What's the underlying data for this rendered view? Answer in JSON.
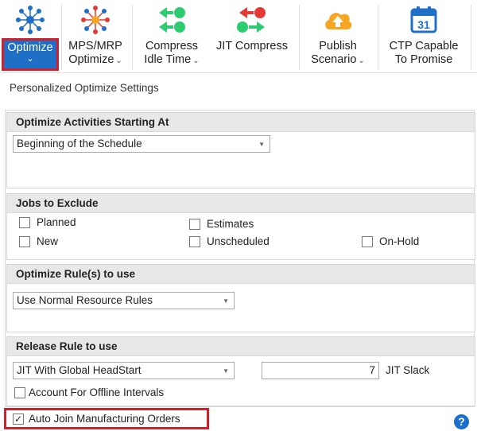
{
  "ribbon": {
    "optimize": {
      "label": "Optimize",
      "caret": "⌄"
    },
    "mps_mrp": {
      "line1": "MPS/MRP",
      "line2": "Optimize",
      "caret": "⌄"
    },
    "compress": {
      "line1": "Compress",
      "line2": "Idle Time",
      "caret": "⌄"
    },
    "jit": {
      "line1": "JIT Compress"
    },
    "publish": {
      "line1": "Publish",
      "line2": "Scenario",
      "caret": "⌄"
    },
    "ctp": {
      "line1": "CTP Capable",
      "line2": "To Promise",
      "calendar_day": "31"
    }
  },
  "page_title": "Personalized Optimize Settings",
  "groups": {
    "start": {
      "title": "Optimize Activities Starting At",
      "value": "Beginning of the Schedule"
    },
    "exclude": {
      "title": "Jobs to Exclude",
      "planned": "Planned",
      "estimates": "Estimates",
      "new": "New",
      "unscheduled": "Unscheduled",
      "onhold": "On-Hold"
    },
    "rules": {
      "title": "Optimize Rule(s) to use",
      "value": "Use Normal Resource Rules"
    },
    "release": {
      "title": "Release Rule to use",
      "value": "JIT With Global HeadStart",
      "slack_value": "7",
      "slack_label": "JIT Slack",
      "offline": "Account For Offline Intervals"
    }
  },
  "auto_join": {
    "label": "Auto Join Manufacturing Orders",
    "checked": "✓"
  },
  "help": "?",
  "colors": {
    "accent": "#1f6fc6",
    "highlight": "#d0202a",
    "green": "#2ecc71",
    "red": "#e53935",
    "orange": "#f5a623"
  }
}
